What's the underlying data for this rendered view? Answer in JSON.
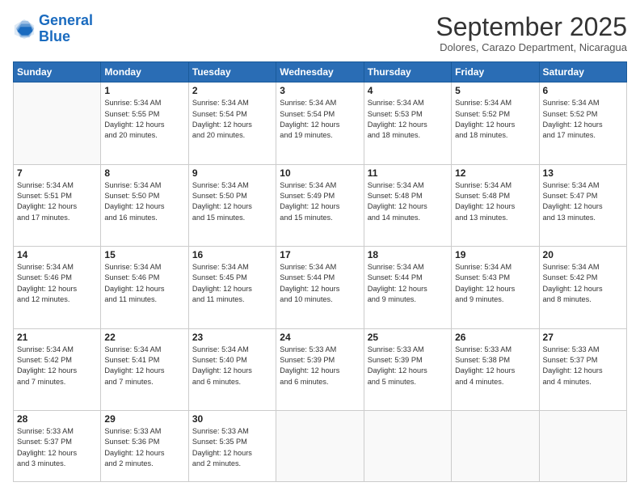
{
  "logo": {
    "line1": "General",
    "line2": "Blue"
  },
  "header": {
    "month": "September 2025",
    "location": "Dolores, Carazo Department, Nicaragua"
  },
  "weekdays": [
    "Sunday",
    "Monday",
    "Tuesday",
    "Wednesday",
    "Thursday",
    "Friday",
    "Saturday"
  ],
  "weeks": [
    [
      {
        "day": "",
        "info": ""
      },
      {
        "day": "1",
        "info": "Sunrise: 5:34 AM\nSunset: 5:55 PM\nDaylight: 12 hours\nand 20 minutes."
      },
      {
        "day": "2",
        "info": "Sunrise: 5:34 AM\nSunset: 5:54 PM\nDaylight: 12 hours\nand 20 minutes."
      },
      {
        "day": "3",
        "info": "Sunrise: 5:34 AM\nSunset: 5:54 PM\nDaylight: 12 hours\nand 19 minutes."
      },
      {
        "day": "4",
        "info": "Sunrise: 5:34 AM\nSunset: 5:53 PM\nDaylight: 12 hours\nand 18 minutes."
      },
      {
        "day": "5",
        "info": "Sunrise: 5:34 AM\nSunset: 5:52 PM\nDaylight: 12 hours\nand 18 minutes."
      },
      {
        "day": "6",
        "info": "Sunrise: 5:34 AM\nSunset: 5:52 PM\nDaylight: 12 hours\nand 17 minutes."
      }
    ],
    [
      {
        "day": "7",
        "info": "Sunrise: 5:34 AM\nSunset: 5:51 PM\nDaylight: 12 hours\nand 17 minutes."
      },
      {
        "day": "8",
        "info": "Sunrise: 5:34 AM\nSunset: 5:50 PM\nDaylight: 12 hours\nand 16 minutes."
      },
      {
        "day": "9",
        "info": "Sunrise: 5:34 AM\nSunset: 5:50 PM\nDaylight: 12 hours\nand 15 minutes."
      },
      {
        "day": "10",
        "info": "Sunrise: 5:34 AM\nSunset: 5:49 PM\nDaylight: 12 hours\nand 15 minutes."
      },
      {
        "day": "11",
        "info": "Sunrise: 5:34 AM\nSunset: 5:48 PM\nDaylight: 12 hours\nand 14 minutes."
      },
      {
        "day": "12",
        "info": "Sunrise: 5:34 AM\nSunset: 5:48 PM\nDaylight: 12 hours\nand 13 minutes."
      },
      {
        "day": "13",
        "info": "Sunrise: 5:34 AM\nSunset: 5:47 PM\nDaylight: 12 hours\nand 13 minutes."
      }
    ],
    [
      {
        "day": "14",
        "info": "Sunrise: 5:34 AM\nSunset: 5:46 PM\nDaylight: 12 hours\nand 12 minutes."
      },
      {
        "day": "15",
        "info": "Sunrise: 5:34 AM\nSunset: 5:46 PM\nDaylight: 12 hours\nand 11 minutes."
      },
      {
        "day": "16",
        "info": "Sunrise: 5:34 AM\nSunset: 5:45 PM\nDaylight: 12 hours\nand 11 minutes."
      },
      {
        "day": "17",
        "info": "Sunrise: 5:34 AM\nSunset: 5:44 PM\nDaylight: 12 hours\nand 10 minutes."
      },
      {
        "day": "18",
        "info": "Sunrise: 5:34 AM\nSunset: 5:44 PM\nDaylight: 12 hours\nand 9 minutes."
      },
      {
        "day": "19",
        "info": "Sunrise: 5:34 AM\nSunset: 5:43 PM\nDaylight: 12 hours\nand 9 minutes."
      },
      {
        "day": "20",
        "info": "Sunrise: 5:34 AM\nSunset: 5:42 PM\nDaylight: 12 hours\nand 8 minutes."
      }
    ],
    [
      {
        "day": "21",
        "info": "Sunrise: 5:34 AM\nSunset: 5:42 PM\nDaylight: 12 hours\nand 7 minutes."
      },
      {
        "day": "22",
        "info": "Sunrise: 5:34 AM\nSunset: 5:41 PM\nDaylight: 12 hours\nand 7 minutes."
      },
      {
        "day": "23",
        "info": "Sunrise: 5:34 AM\nSunset: 5:40 PM\nDaylight: 12 hours\nand 6 minutes."
      },
      {
        "day": "24",
        "info": "Sunrise: 5:33 AM\nSunset: 5:39 PM\nDaylight: 12 hours\nand 6 minutes."
      },
      {
        "day": "25",
        "info": "Sunrise: 5:33 AM\nSunset: 5:39 PM\nDaylight: 12 hours\nand 5 minutes."
      },
      {
        "day": "26",
        "info": "Sunrise: 5:33 AM\nSunset: 5:38 PM\nDaylight: 12 hours\nand 4 minutes."
      },
      {
        "day": "27",
        "info": "Sunrise: 5:33 AM\nSunset: 5:37 PM\nDaylight: 12 hours\nand 4 minutes."
      }
    ],
    [
      {
        "day": "28",
        "info": "Sunrise: 5:33 AM\nSunset: 5:37 PM\nDaylight: 12 hours\nand 3 minutes."
      },
      {
        "day": "29",
        "info": "Sunrise: 5:33 AM\nSunset: 5:36 PM\nDaylight: 12 hours\nand 2 minutes."
      },
      {
        "day": "30",
        "info": "Sunrise: 5:33 AM\nSunset: 5:35 PM\nDaylight: 12 hours\nand 2 minutes."
      },
      {
        "day": "",
        "info": ""
      },
      {
        "day": "",
        "info": ""
      },
      {
        "day": "",
        "info": ""
      },
      {
        "day": "",
        "info": ""
      }
    ]
  ]
}
